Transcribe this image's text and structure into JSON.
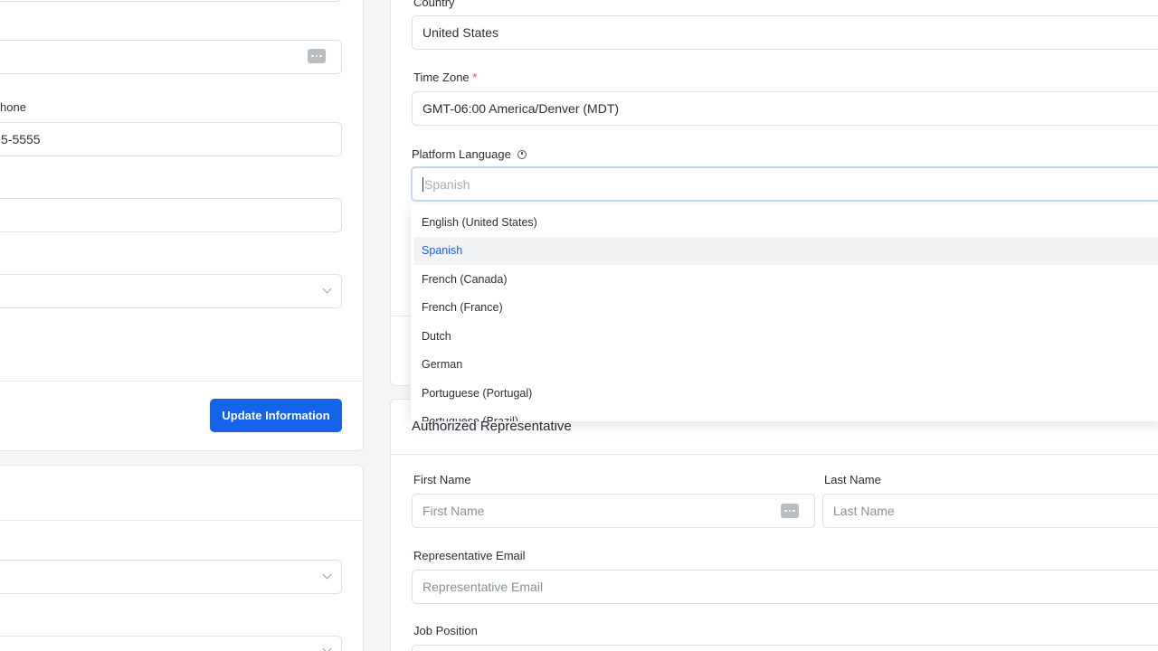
{
  "left_panel": {
    "phone_label": "hone",
    "phone_value": "5-5555",
    "update_button": "Update Information"
  },
  "right_panel": {
    "country_label": "Country",
    "country_value": "United States",
    "timezone_label": "Time Zone",
    "timezone_required": "*",
    "timezone_value": "GMT-06:00 America/Denver (MDT)",
    "language_label": "Platform Language",
    "language_value": "Spanish",
    "language_options": [
      "English (United States)",
      "Spanish",
      "French (Canada)",
      "French (France)",
      "Dutch",
      "German",
      "Portuguese (Portugal)",
      "Portuguese (Brazil)"
    ],
    "selected_option": "Spanish"
  },
  "representative": {
    "title": "Authorized Representative",
    "first_name_label": "First Name",
    "first_name_placeholder": "First Name",
    "last_name_label": "Last Name",
    "last_name_placeholder": "Last Name",
    "email_label": "Representative Email",
    "email_placeholder": "Representative Email",
    "job_label": "Job Position"
  },
  "colors": {
    "primary": "#1463e8",
    "required": "#e5484d",
    "selected_bg": "#f2f3f5"
  }
}
